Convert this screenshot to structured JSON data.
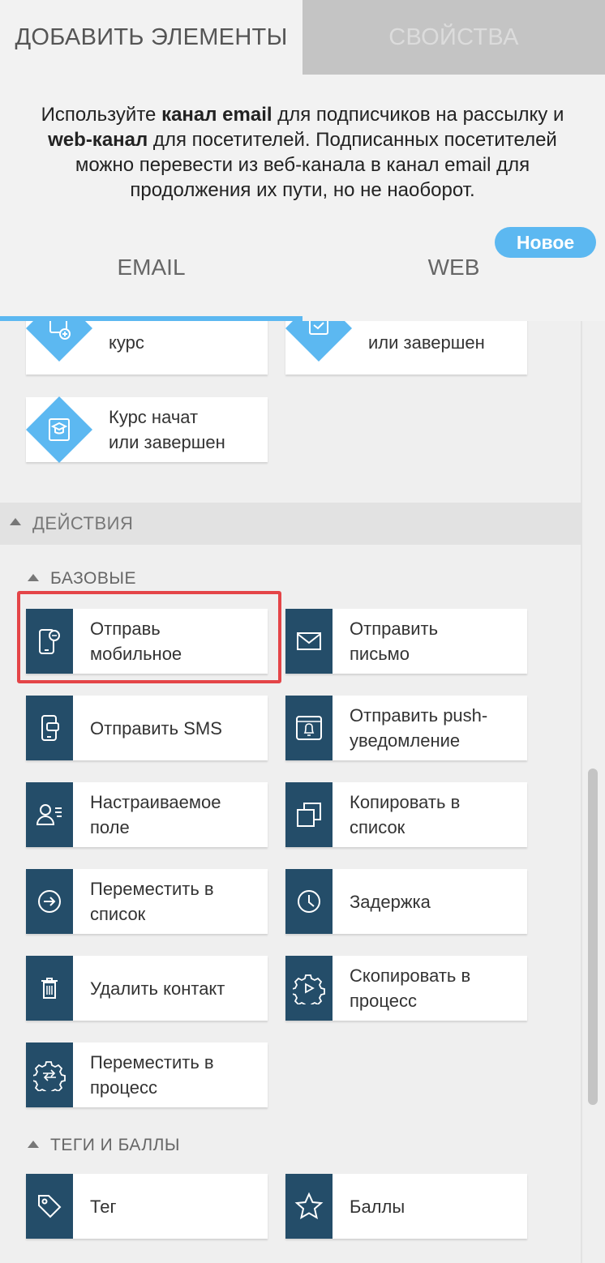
{
  "tabs": {
    "add_elements": "ДОБАВИТЬ ЭЛЕМЕНТЫ",
    "properties": "СВОЙСТВА"
  },
  "info": {
    "part1": "Используйте ",
    "bold1": "канал email",
    "part2": " для подписчиков на рассылку и ",
    "bold2": "web-канал",
    "part3": " для посетителей. Подписанных посетителей можно перевести из веб-канала в канал email для продолжения их пути, но не наоборот."
  },
  "badge": "Новое",
  "channels": {
    "email": "EMAIL",
    "web": "WEB",
    "active": "EMAIL"
  },
  "triggers": {
    "items": [
      {
        "label": "курс",
        "icon": "course-add-icon"
      },
      {
        "label": "или завершен",
        "icon": "course-check-icon"
      },
      {
        "label_line1": "Курс начат",
        "label_line2": "или завершен",
        "icon": "graduation-cap-icon"
      }
    ]
  },
  "actions": {
    "section_title": "ДЕЙСТВИЯ",
    "basic": {
      "title": "БАЗОВЫЕ",
      "items": [
        {
          "line1": "Отправь",
          "line2": "мобильное",
          "icon": "mobile-message-icon",
          "highlighted": true
        },
        {
          "line1": "Отправить",
          "line2": "письмо",
          "icon": "envelope-icon"
        },
        {
          "line1": "Отправить SMS",
          "line2": "",
          "icon": "sms-phone-icon"
        },
        {
          "line1": "Отправить push-",
          "line2": "уведомление",
          "icon": "push-bell-icon"
        },
        {
          "line1": "Настраиваемое",
          "line2": "поле",
          "icon": "user-field-icon"
        },
        {
          "line1": "Копировать в",
          "line2": "список",
          "icon": "copy-icon"
        },
        {
          "line1": "Переместить в",
          "line2": "список",
          "icon": "arrow-circle-icon"
        },
        {
          "line1": "Задержка",
          "line2": "",
          "icon": "clock-icon"
        },
        {
          "line1": "Удалить контакт",
          "line2": "",
          "icon": "trash-icon"
        },
        {
          "line1": "Скопировать в",
          "line2": "процесс",
          "icon": "gear-copy-icon"
        },
        {
          "line1": "Переместить в",
          "line2": "процесс",
          "icon": "gear-move-icon"
        }
      ]
    },
    "tags": {
      "title": "ТЕГИ И БАЛЛЫ",
      "items": [
        {
          "line1": "Тег",
          "line2": "",
          "icon": "tag-icon"
        },
        {
          "line1": "Баллы",
          "line2": "",
          "icon": "star-icon"
        }
      ]
    }
  },
  "colors": {
    "accent": "#5cb8f1",
    "icon_bg": "#244d69",
    "highlight": "#e44548"
  }
}
